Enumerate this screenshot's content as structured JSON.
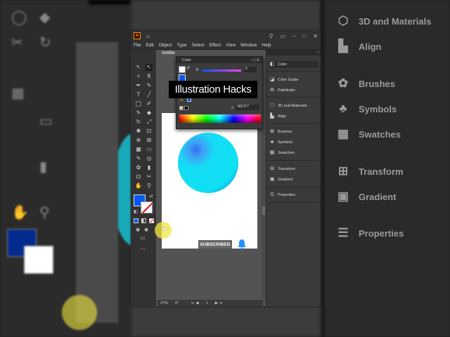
{
  "overlay_title": "Illustration Hacks",
  "subscribe_label": "SUBSCRIBED",
  "app": {
    "logo": "Ai",
    "menu": [
      "File",
      "Edit",
      "Object",
      "Type",
      "Select",
      "Effect",
      "View",
      "Window",
      "Help"
    ],
    "doc_tab": "Untitle",
    "zoom": "27%",
    "rotation": "0°",
    "artboard_num": "1"
  },
  "color_panel": {
    "title": "Color",
    "hex_label": "#",
    "hex_value": "0657F7",
    "value": "6"
  },
  "right_panel": {
    "items": [
      {
        "label": "Color",
        "icon": "color-icon"
      },
      {
        "label": "Color Guide",
        "icon": "color-guide-icon"
      },
      {
        "label": "Pathfinder",
        "icon": "pathfinder-icon"
      },
      {
        "label": "3D and Materials",
        "icon": "cube-icon"
      },
      {
        "label": "Align",
        "icon": "align-icon"
      },
      {
        "label": "Brushes",
        "icon": "brush-icon"
      },
      {
        "label": "Symbols",
        "icon": "club-icon"
      },
      {
        "label": "Swatches",
        "icon": "grid-icon"
      },
      {
        "label": "Transform",
        "icon": "transform-icon"
      },
      {
        "label": "Gradient",
        "icon": "gradient-icon"
      },
      {
        "label": "Properties",
        "icon": "sliders-icon"
      }
    ]
  },
  "blurred_right": {
    "items": [
      "3D and Materials",
      "Align",
      "Brushes",
      "Symbols",
      "Swatches",
      "Transform",
      "Gradient",
      "Properties"
    ]
  },
  "colors": {
    "fill_blue": "#0657F7",
    "circle_cyan": "#12DCF5",
    "accent_yellow": "#F0E63C",
    "bell_blue": "#1E90FF"
  }
}
